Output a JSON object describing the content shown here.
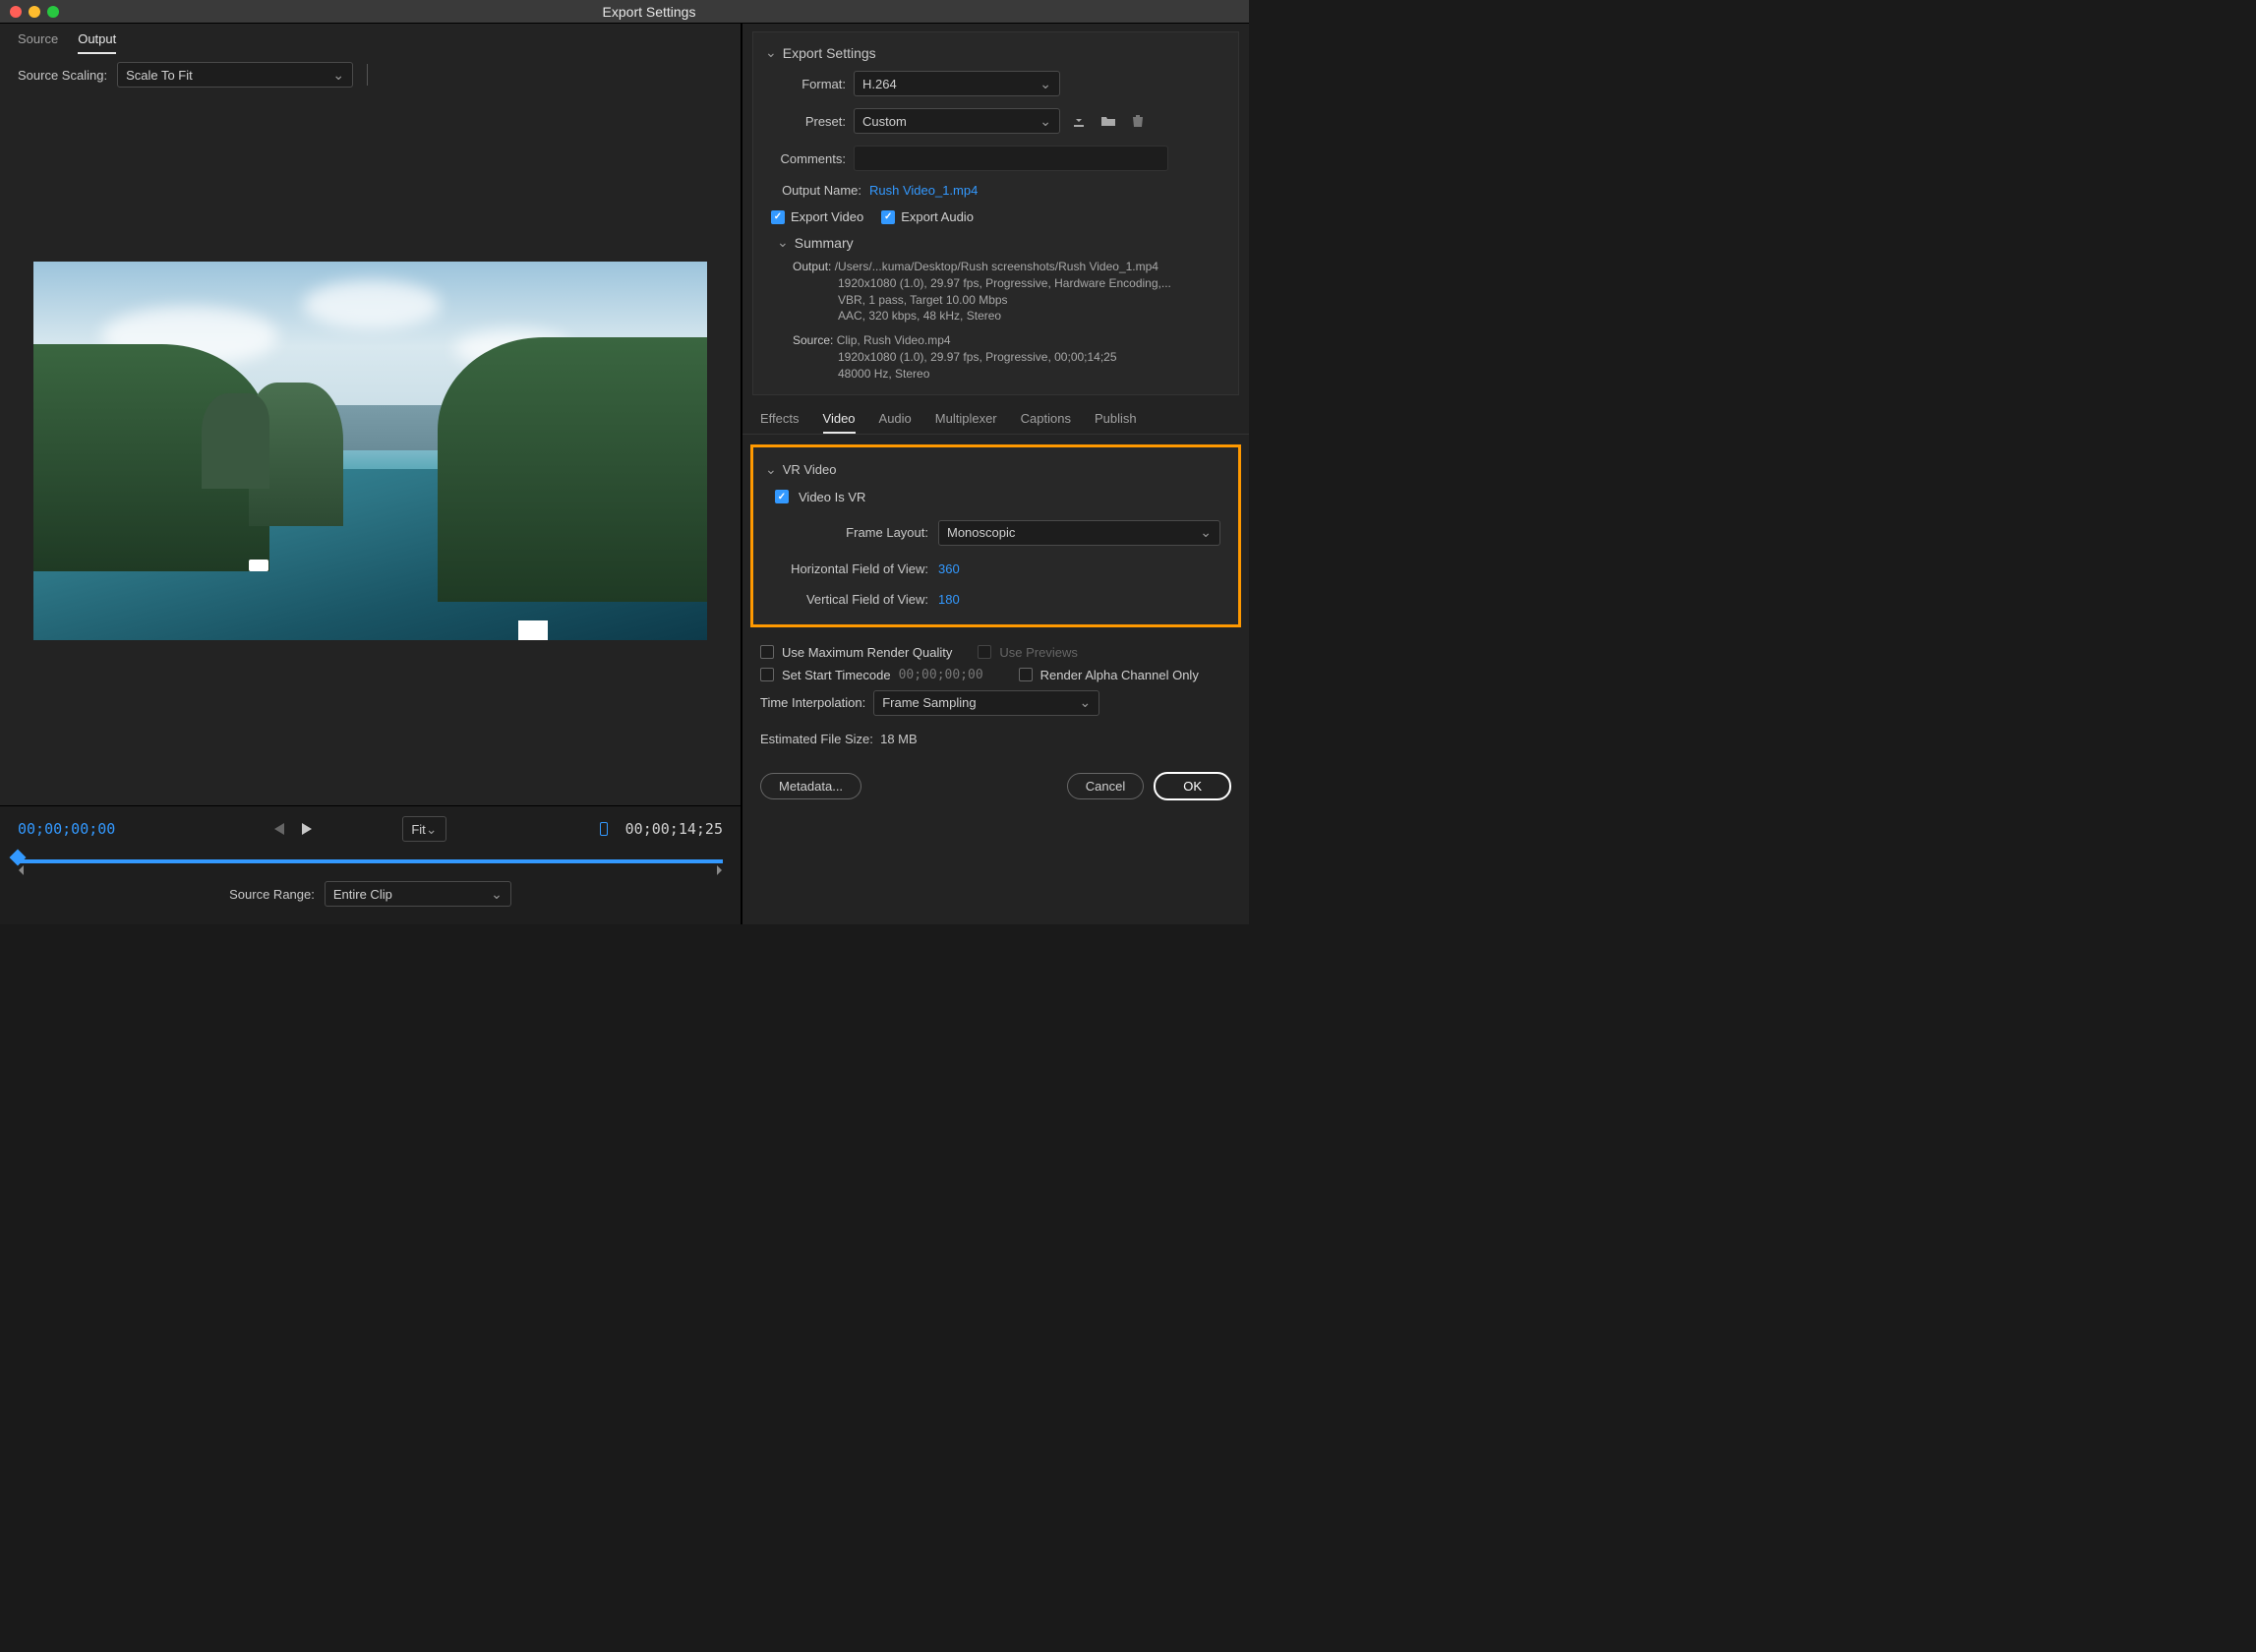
{
  "titlebar": {
    "title": "Export Settings"
  },
  "left": {
    "tabs": {
      "source": "Source",
      "output": "Output"
    },
    "sourceScaling": {
      "label": "Source Scaling:",
      "value": "Scale To Fit"
    },
    "transport": {
      "timecodeStart": "00;00;00;00",
      "timecodeEnd": "00;00;14;25",
      "fit": "Fit",
      "sourceRange": {
        "label": "Source Range:",
        "value": "Entire Clip"
      }
    }
  },
  "exportSettings": {
    "title": "Export Settings",
    "format": {
      "label": "Format:",
      "value": "H.264"
    },
    "preset": {
      "label": "Preset:",
      "value": "Custom"
    },
    "comments": {
      "label": "Comments:",
      "value": ""
    },
    "outputName": {
      "label": "Output Name:",
      "value": "Rush Video_1.mp4"
    },
    "exportVideo": {
      "label": "Export Video"
    },
    "exportAudio": {
      "label": "Export Audio"
    },
    "summary": {
      "title": "Summary",
      "outputLabel": "Output:",
      "outputPath": "/Users/...kuma/Desktop/Rush screenshots/Rush Video_1.mp4",
      "outputLine2": "1920x1080 (1.0), 29.97 fps, Progressive, Hardware Encoding,...",
      "outputLine3": "VBR, 1 pass, Target 10.00 Mbps",
      "outputLine4": "AAC, 320 kbps, 48 kHz, Stereo",
      "sourceLabel": "Source:",
      "sourcePath": "Clip, Rush Video.mp4",
      "sourceLine2": "1920x1080 (1.0), 29.97 fps, Progressive, 00;00;14;25",
      "sourceLine3": "48000 Hz, Stereo"
    }
  },
  "settingsTabs": {
    "effects": "Effects",
    "video": "Video",
    "audio": "Audio",
    "multiplexer": "Multiplexer",
    "captions": "Captions",
    "publish": "Publish"
  },
  "vr": {
    "title": "VR Video",
    "videoIsVR": "Video Is VR",
    "frameLayout": {
      "label": "Frame Layout:",
      "value": "Monoscopic"
    },
    "hFov": {
      "label": "Horizontal Field of View:",
      "value": "360"
    },
    "vFov": {
      "label": "Vertical Field of View:",
      "value": "180"
    }
  },
  "options": {
    "maxQuality": "Use Maximum Render Quality",
    "usePreviews": "Use Previews",
    "setStartTC": "Set Start Timecode",
    "startTC": "00;00;00;00",
    "renderAlpha": "Render Alpha Channel Only",
    "timeInterpolation": {
      "label": "Time Interpolation:",
      "value": "Frame Sampling"
    }
  },
  "footer": {
    "estLabel": "Estimated File Size:",
    "estValue": "18 MB",
    "metadata": "Metadata...",
    "cancel": "Cancel",
    "ok": "OK"
  }
}
